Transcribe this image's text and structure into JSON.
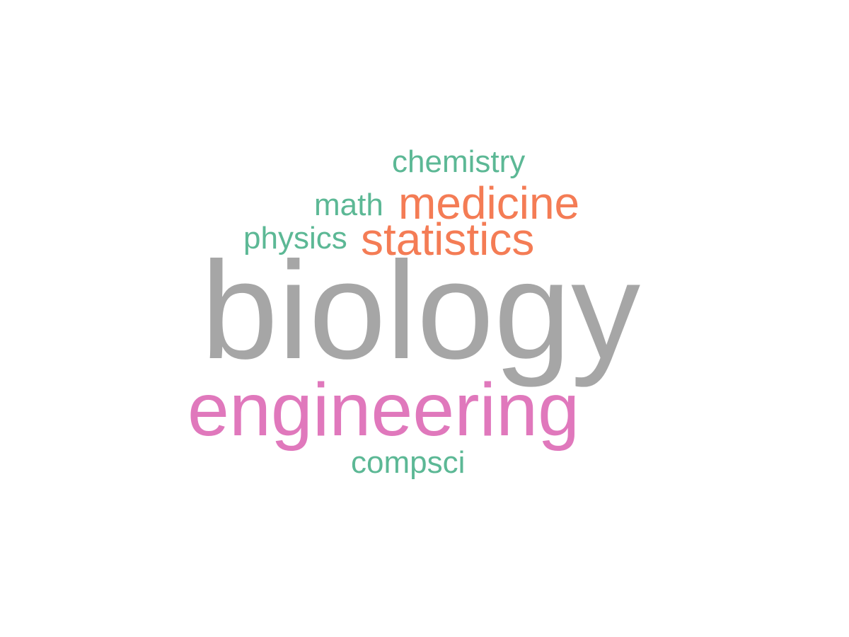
{
  "word_cloud": {
    "words": [
      {
        "id": "biology",
        "text": "biology",
        "color": "#a6a6a6",
        "size_rank": 1
      },
      {
        "id": "engineering",
        "text": "engineering",
        "color": "#e078bc",
        "size_rank": 2
      },
      {
        "id": "medicine",
        "text": "medicine",
        "color": "#f47c55",
        "size_rank": 3
      },
      {
        "id": "statistics",
        "text": "statistics",
        "color": "#f47c55",
        "size_rank": 3
      },
      {
        "id": "chemistry",
        "text": "chemistry",
        "color": "#5cb895",
        "size_rank": 4
      },
      {
        "id": "math",
        "text": "math",
        "color": "#5cb895",
        "size_rank": 4
      },
      {
        "id": "physics",
        "text": "physics",
        "color": "#5cb895",
        "size_rank": 4
      },
      {
        "id": "compsci",
        "text": "compsci",
        "color": "#5cb895",
        "size_rank": 4
      }
    ]
  }
}
